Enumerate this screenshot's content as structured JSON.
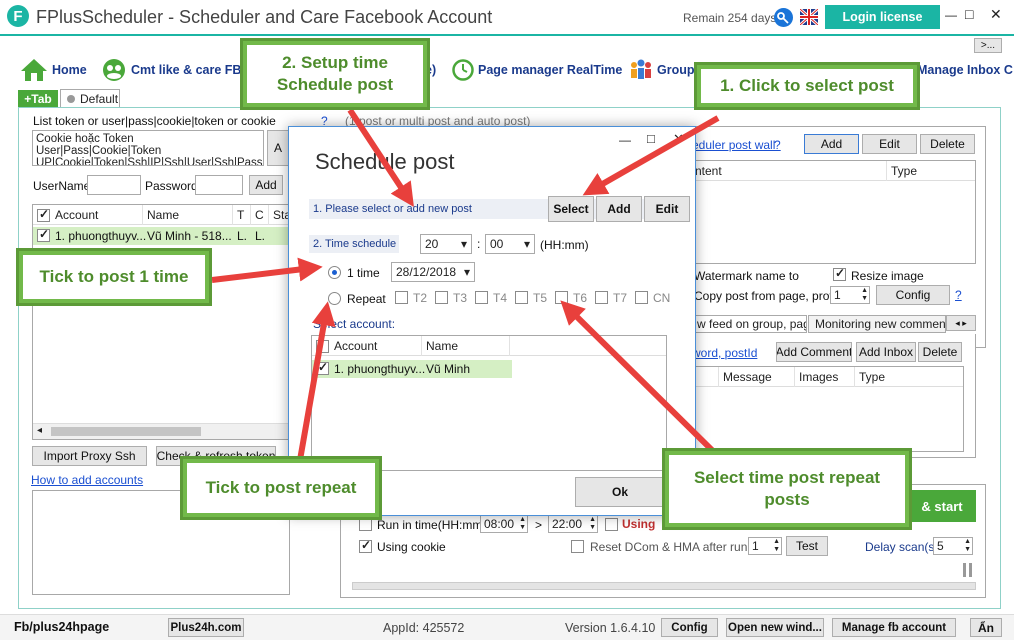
{
  "window": {
    "title": "FPlusScheduler - Scheduler and Care Facebook Account",
    "remain": "Remain 254 days",
    "login_label": "Login license",
    "more_label": ">...",
    "minimize": "—",
    "maximize": "□",
    "close": "✕"
  },
  "nav": {
    "home": "Home",
    "cmt": "Cmt like & care FB",
    "schedule_partial": "e)",
    "page_manager": "Page manager RealTime",
    "group": "Group",
    "manage_inbox": "Manage Inbox C"
  },
  "tabs": {
    "plus": "+Tab",
    "default": "Default"
  },
  "left": {
    "list_label": "List token or user|pass|cookie|token or cookie",
    "textarea_lines": [
      "Cookie hoặc Token",
      "User|Pass|Cookie|Token",
      "UP|Cookie|Token|Ssh|IP|Ssh|User|Ssh|Pass"
    ],
    "side_btn": "A",
    "username_label": "UserName",
    "password_label": "Password",
    "add": "Add",
    "columns": [
      "Account",
      "Name",
      "T",
      "C",
      "Sta"
    ],
    "row": {
      "account": "1. phuongthuyv...",
      "name": "Vũ Minh - 518...",
      "t": "L.",
      "c": "L."
    },
    "import_proxy": "Import Proxy Ssh",
    "check_refresh": "Check & refresh token",
    "how_to": "How to add accounts"
  },
  "right": {
    "question": "?",
    "hint_partial": "(1 post or multi post and auto post)",
    "scheduler_link": "eduler post wall",
    "add": "Add",
    "edit": "Edit",
    "delete": "Delete",
    "col_content": "ntent",
    "col_type": "Type",
    "watermark": "Watermark name to",
    "resize": "Resize image",
    "copy_post": "Copy post from page, profile,",
    "copy_count": "1",
    "config": "Config",
    "help": "?",
    "tab1": "w feed on group, page",
    "tab2": "Monitoring new comment or",
    "keyword": "word, postId",
    "add_comment": "Add Comment",
    "add_inbox": "Add Inbox",
    "del2": "Delete",
    "cols2": [
      "Message",
      "Images",
      "Type"
    ],
    "start": "& start",
    "run_in_time": "Run in time(HH:mm)",
    "time_from": "08:00",
    "time_to": "22:00",
    "arrow": ">",
    "using": "Using",
    "using_cookie": "Using cookie",
    "reset": "Reset DCom & HMA after runned",
    "reset_count": "1",
    "test": "Test",
    "delay": "Delay scan(s)",
    "delay_value": "5"
  },
  "dialog": {
    "title": "Schedule post",
    "minimize": "—",
    "maximize": "□",
    "close": "✕",
    "step1": "1. Please select or add new post",
    "select": "Select",
    "add": "Add",
    "edit": "Edit",
    "step2": "2. Time schedule",
    "hour": "20",
    "minute": "00",
    "hhmm": "(HH:mm)",
    "one_time": "1 time",
    "date": "28/12/2018",
    "repeat": "Repeat",
    "days": [
      "T2",
      "T3",
      "T4",
      "T5",
      "T6",
      "T7",
      "CN"
    ],
    "select_account": "Select account:",
    "col_account": "Account",
    "col_name": "Name",
    "row_account": "1. phuongthuyv...",
    "row_name": "Vũ Minh",
    "ok": "Ok"
  },
  "callouts": {
    "setup_time": "2. Setup time Schedule post",
    "click_select": "1. Click to select post",
    "tick_one": "Tick to post 1 time",
    "tick_repeat": "Tick to post repeat",
    "repeat_posts": "Select time post repeat posts"
  },
  "status": {
    "page": "Fb/plus24hpage",
    "site": "Plus24h.com",
    "appid": "AppId: 425572",
    "version": "Version 1.6.4.10",
    "config": "Config",
    "open_new": "Open new wind...",
    "manage_fb": "Manage fb account",
    "hide": "Ẩn"
  },
  "colors": {
    "accent_teal": "#1bb5a4",
    "callout_green": "#72b94a",
    "arrow_red": "#e8403c",
    "link_blue": "#1a4fd1"
  }
}
